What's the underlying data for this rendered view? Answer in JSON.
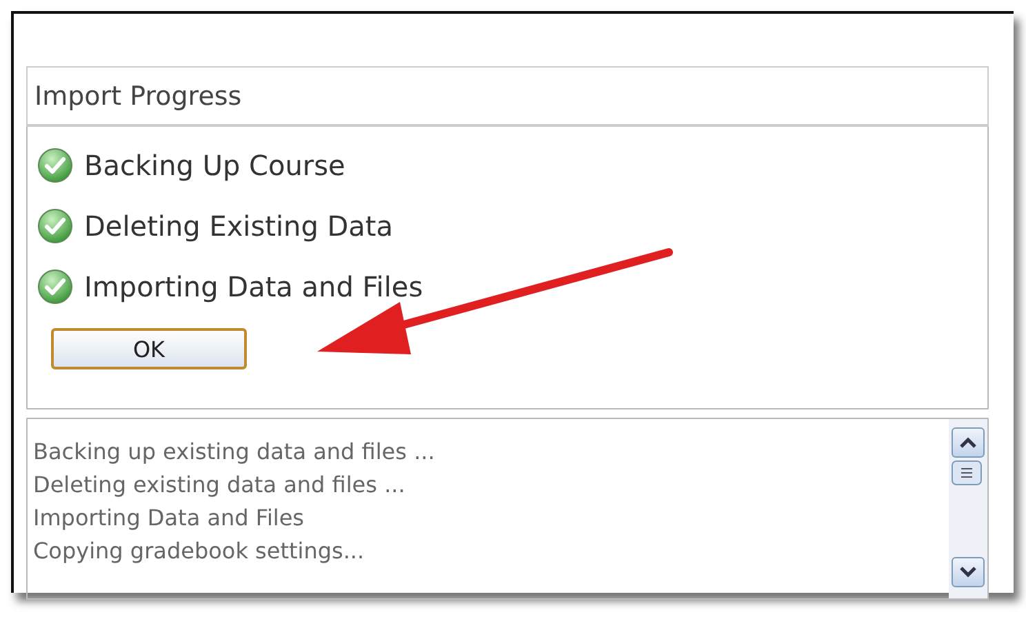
{
  "panel": {
    "title": "Import Progress"
  },
  "steps": [
    {
      "label": "Backing Up Course",
      "done": true
    },
    {
      "label": "Deleting Existing Data",
      "done": true
    },
    {
      "label": "Importing Data and Files",
      "done": true
    }
  ],
  "ok_button": {
    "label": "OK"
  },
  "log": {
    "lines": [
      "Backing up existing data and files ...",
      "Deleting existing data and files ...",
      "Importing Data and Files",
      "Copying gradebook settings..."
    ]
  }
}
